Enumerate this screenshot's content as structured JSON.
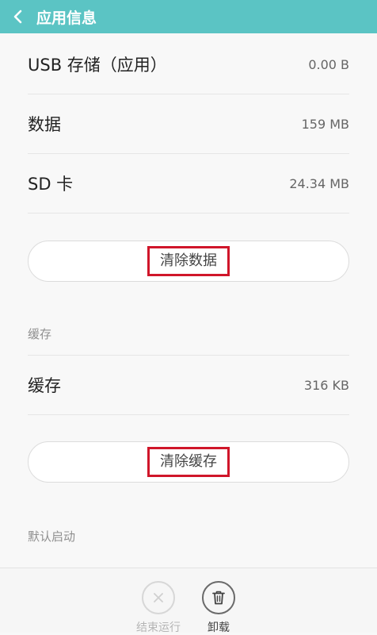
{
  "header": {
    "title": "应用信息",
    "back_icon": "chevron-left-icon",
    "background": "#5bc4c4"
  },
  "storage": {
    "rows": [
      {
        "label": "USB 存储（应用）",
        "value": "0.00 B"
      },
      {
        "label": "数据",
        "value": "159 MB"
      },
      {
        "label": "SD 卡",
        "value": "24.34 MB"
      }
    ],
    "clear_data_label": "清除数据"
  },
  "cache": {
    "section_title": "缓存",
    "row": {
      "label": "缓存",
      "value": "316 KB"
    },
    "clear_cache_label": "清除缓存"
  },
  "default_launch": {
    "section_title": "默认启动"
  },
  "bottom_actions": {
    "force_stop_label": "结束运行",
    "force_stop_icon": "close-icon",
    "uninstall_label": "卸载",
    "uninstall_icon": "trash-icon"
  },
  "highlight_color": "#d0162a"
}
